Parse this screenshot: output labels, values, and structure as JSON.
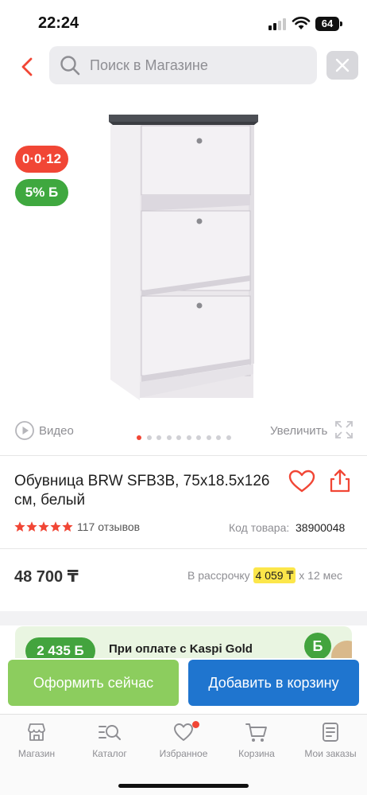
{
  "status_bar": {
    "time": "22:24",
    "battery": "64"
  },
  "header": {
    "search_placeholder": "Поиск в Магазине"
  },
  "gallery": {
    "promo_installment": "0·0·12",
    "promo_bonus": "5% Б",
    "video_label": "Видео",
    "zoom_label": "Увеличить",
    "slides_total": 10,
    "active_slide": 1
  },
  "product": {
    "title": "Обувница BRW SFB3B, 75x18.5x126 см, белый",
    "rating": 5,
    "reviews": "117 отзывов",
    "code_label": "Код товара:",
    "code_value": "38900048"
  },
  "price": {
    "value": "48 700 ₸",
    "installment_prefix": "В рассрочку",
    "installment_amount": "4 059 ₸",
    "installment_suffix": "x 12 мес"
  },
  "gold_banner": {
    "bonus": "2 435 Б",
    "text": "При оплате с Kaspi Gold",
    "badge": "Б"
  },
  "actions": {
    "order_now": "Оформить сейчас",
    "add_to_cart": "Добавить в корзину"
  },
  "tabbar": {
    "items": [
      {
        "label": "Магазин",
        "icon": "store-icon"
      },
      {
        "label": "Каталог",
        "icon": "catalog-search-icon"
      },
      {
        "label": "Избранное",
        "icon": "heart-icon"
      },
      {
        "label": "Корзина",
        "icon": "cart-icon"
      },
      {
        "label": "Мои заказы",
        "icon": "orders-icon"
      }
    ]
  },
  "colors": {
    "accent_red": "#f14635",
    "green": "#3fa83f",
    "order_button": "#8ccd5e",
    "cart_button": "#1f75cf",
    "installment_highlight": "#fce64a"
  }
}
